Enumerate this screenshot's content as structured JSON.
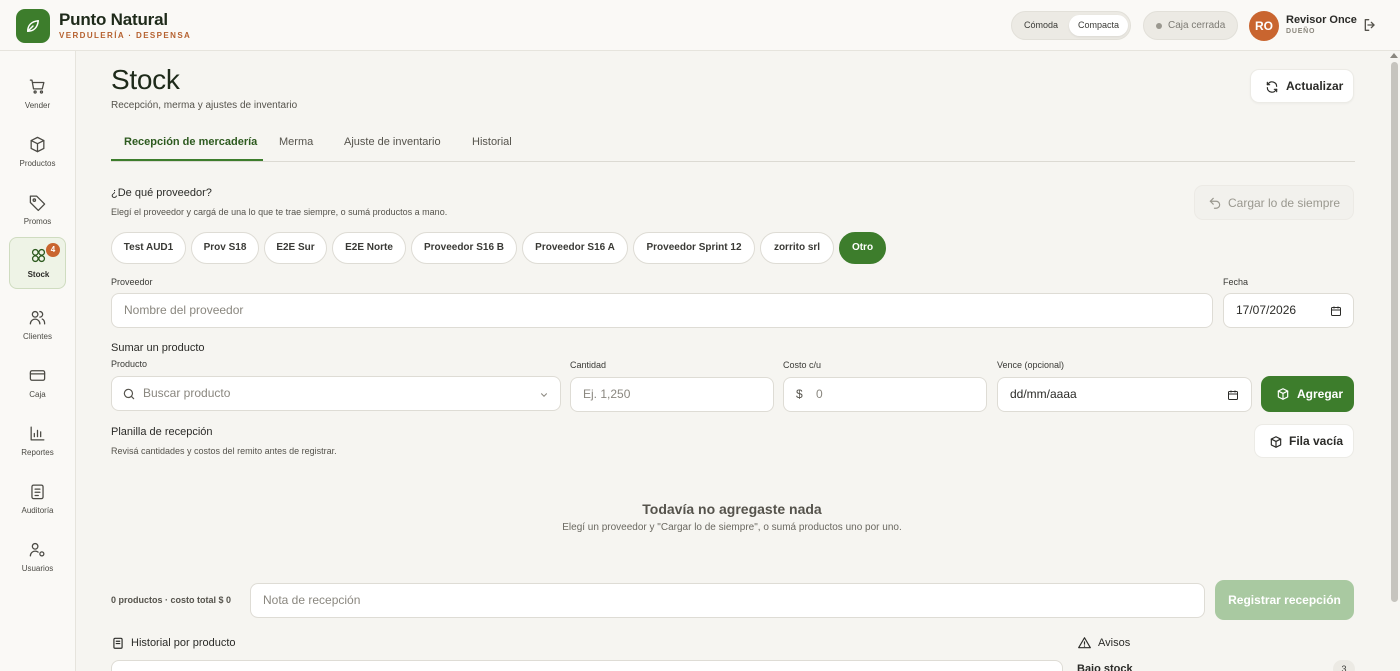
{
  "brand": {
    "name": "Punto Natural",
    "subtitle": "VERDULERÍA · DESPENSA"
  },
  "topbar": {
    "density": {
      "option_a": "Cómoda",
      "option_b": "Compacta",
      "selected": "Compacta"
    },
    "caja_status": "Caja cerrada",
    "user": {
      "initials": "RO",
      "name": "Revisor Once",
      "role": "DUEÑO"
    }
  },
  "sidebar": {
    "items": [
      {
        "label": "Vender",
        "icon": "cart-icon"
      },
      {
        "label": "Productos",
        "icon": "box-icon"
      },
      {
        "label": "Promos",
        "icon": "tag-icon"
      },
      {
        "label": "Stock",
        "icon": "stock-icon",
        "badge": "4",
        "active": true
      },
      {
        "label": "Clientes",
        "icon": "users-icon"
      },
      {
        "label": "Caja",
        "icon": "card-icon"
      },
      {
        "label": "Reportes",
        "icon": "chart-icon"
      },
      {
        "label": "Auditoría",
        "icon": "clipboard-icon"
      },
      {
        "label": "Usuarios",
        "icon": "user-settings-icon"
      }
    ]
  },
  "page": {
    "title": "Stock",
    "subtitle": "Recepción, merma y ajustes de inventario",
    "refresh_label": "Actualizar"
  },
  "tabs": [
    {
      "label": "Recepción de mercadería",
      "active": true
    },
    {
      "label": "Merma"
    },
    {
      "label": "Ajuste de inventario"
    },
    {
      "label": "Historial"
    }
  ],
  "supplier": {
    "question": "¿De qué proveedor?",
    "hint": "Elegí el proveedor y cargá de una lo que te trae siempre, o sumá productos a mano.",
    "load_usual_label": "Cargar lo de siempre",
    "chips": [
      "Test AUD1",
      "Prov S18",
      "E2E Sur",
      "E2E Norte",
      "Proveedor S16 B",
      "Proveedor S16 A",
      "Proveedor Sprint 12",
      "zorrito srl",
      "Otro"
    ],
    "selected_chip": "Otro",
    "field_label": "Proveedor",
    "field_placeholder": "Nombre del proveedor",
    "date_label": "Fecha",
    "date_value": "17/07/2026"
  },
  "add_product": {
    "section_label": "Sumar un producto",
    "product_label": "Producto",
    "product_placeholder": "Buscar producto",
    "qty_label": "Cantidad",
    "qty_placeholder": "Ej. 1,250",
    "cost_label": "Costo c/u",
    "cost_prefix": "$",
    "cost_placeholder": "0",
    "expiry_label": "Vence (opcional)",
    "expiry_placeholder": "dd/mm/aaaa",
    "add_label": "Agregar"
  },
  "sheet": {
    "title": "Planilla de recepción",
    "hint": "Revisá cantidades y costos del remito antes de registrar.",
    "empty_row_label": "Fila vacía",
    "empty_title": "Todavía no agregaste nada",
    "empty_sub": "Elegí un proveedor y \"Cargar lo de siempre\", o sumá productos uno por uno."
  },
  "footer": {
    "summary": "0 productos · costo total $ 0",
    "note_placeholder": "Nota de recepción",
    "register_label": "Registrar recepción"
  },
  "bottom": {
    "history_label": "Historial por producto",
    "alerts_label": "Avisos",
    "low_stock_label": "Bajo stock",
    "low_stock_count": "3"
  },
  "colors": {
    "accent": "#3d7d2c",
    "brand_orange": "#c9652f",
    "background": "#f6f5f1",
    "disabled_green": "#a9c9a1"
  }
}
